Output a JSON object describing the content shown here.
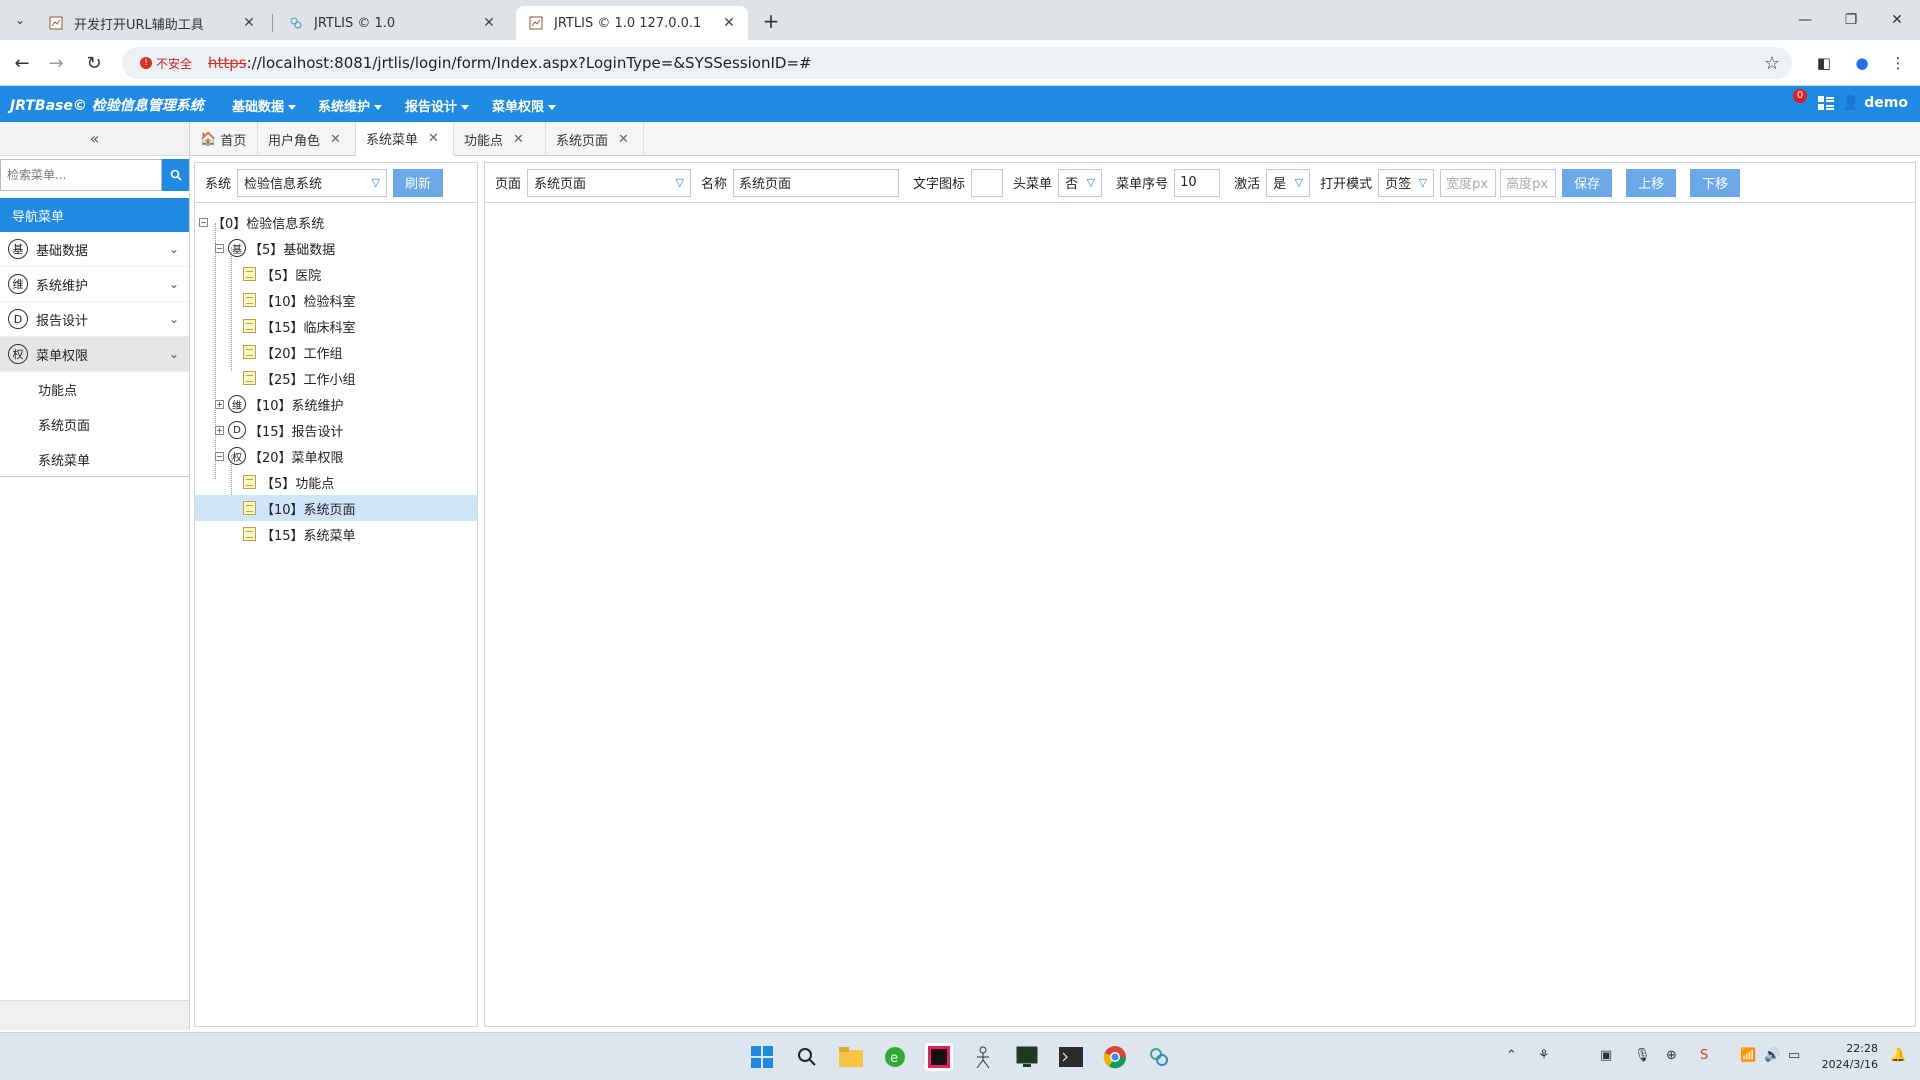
{
  "browser": {
    "tabs": [
      {
        "title": "开发打开URL辅助工具",
        "active": false
      },
      {
        "title": "JRTLIS © 1.0",
        "active": false
      },
      {
        "title": "JRTLIS © 1.0 127.0.0.1",
        "active": true
      }
    ],
    "security_label": "不安全",
    "url_scheme": "https",
    "url_rest": "://localhost:8081/jrtlis/login/form/Index.aspx?LoginType=&SYSSessionID=#"
  },
  "app": {
    "brand": "JRTBase© 检验信息管理系统",
    "top_menus": [
      "基础数据",
      "系统维护",
      "报告设计",
      "菜单权限"
    ],
    "notification_count": "0",
    "user": "demo"
  },
  "sidebar": {
    "search_placeholder": "检索菜单...",
    "nav_header": "导航菜单",
    "groups": [
      {
        "icon": "基",
        "label": "基础数据"
      },
      {
        "icon": "维",
        "label": "系统维护"
      },
      {
        "icon": "D",
        "label": "报告设计"
      },
      {
        "icon": "权",
        "label": "菜单权限"
      }
    ],
    "sub_items": [
      "功能点",
      "系统页面",
      "系统菜单"
    ]
  },
  "content_tabs": [
    "首页",
    "用户角色",
    "系统菜单",
    "功能点",
    "系统页面"
  ],
  "left_toolbar": {
    "system_label": "系统",
    "system_value": "检验信息系统",
    "refresh_label": "刷新"
  },
  "right_toolbar": {
    "page_label": "页面",
    "page_value": "系统页面",
    "name_label": "名称",
    "name_value": "系统页面",
    "text_icon_label": "文字图标",
    "text_icon_value": "",
    "head_menu_label": "头菜单",
    "head_menu_value": "否",
    "order_label": "菜单序号",
    "order_value": "10",
    "active_label": "激活",
    "active_value": "是",
    "open_mode_label": "打开模式",
    "open_mode_value": "页签",
    "width_placeholder": "宽度px",
    "height_placeholder": "高度px",
    "save_label": "保存",
    "up_label": "上移",
    "down_label": "下移"
  },
  "tree": [
    {
      "text": "【0】检验信息系统"
    },
    {
      "icon": "基",
      "text": "【5】基础数据"
    },
    {
      "text": "【5】医院"
    },
    {
      "text": "【10】检验科室"
    },
    {
      "text": "【15】临床科室"
    },
    {
      "text": "【20】工作组"
    },
    {
      "text": "【25】工作小组"
    },
    {
      "icon": "维",
      "text": "【10】系统维护"
    },
    {
      "icon": "D",
      "text": "【15】报告设计"
    },
    {
      "icon": "权",
      "text": "【20】菜单权限"
    },
    {
      "text": "【5】功能点"
    },
    {
      "text": "【10】系统页面"
    },
    {
      "text": "【15】系统菜单"
    }
  ],
  "taskbar": {
    "time": "22:28",
    "date": "2024/3/16"
  },
  "colors": {
    "accent": "#1f8ae3",
    "button": "#6aa8e8",
    "selected": "#cfe5fa"
  }
}
